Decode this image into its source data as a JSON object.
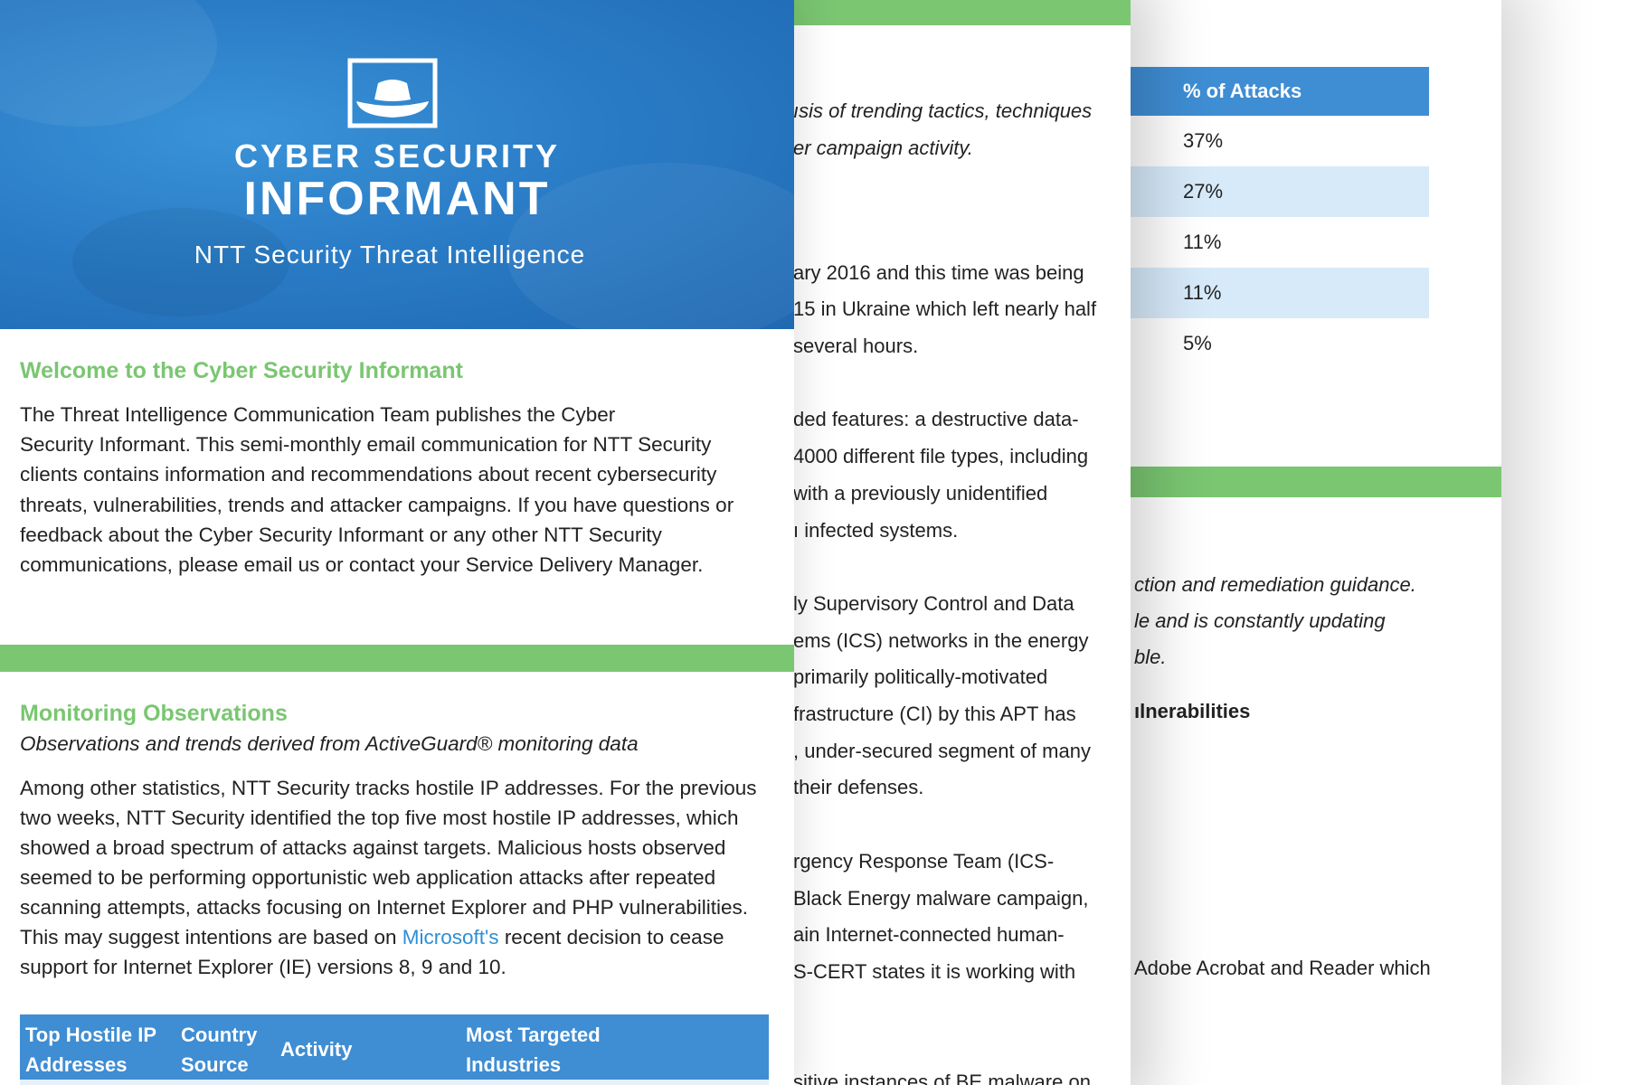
{
  "back_page": {
    "table": {
      "header": "% of Attacks",
      "rows": [
        "37%",
        "27%",
        "11%",
        "11%",
        "5%"
      ]
    },
    "lines": [
      "ction and remediation guidance.",
      "le and is constantly updating",
      "ble.",
      "ılnerabilities",
      "Adobe Acrobat and Reader which"
    ]
  },
  "middle_page": {
    "intro_lines": [
      "ısis of trending tactics, techniques",
      "er campaign activity."
    ],
    "body_lines": [
      "ary 2016 and this time was being",
      "15 in Ukraine which left nearly half",
      "several hours.",
      "ded features: a destructive data-",
      "4000 different file types, including",
      "with a previously unidentified",
      "ı infected systems.",
      "ly Supervisory Control and Data",
      "ems (ICS) networks in the energy",
      "primarily politically-motivated",
      "frastructure (CI) by this APT has",
      ", under-secured segment of many",
      "their defenses.",
      "rgency Response Team (ICS-",
      "Black Energy malware campaign,",
      "ain Internet-connected human-",
      "S-CERT states it is working with",
      "sitive instances of BE malware on"
    ]
  },
  "banner": {
    "title_line1": "CYBER SECURITY",
    "title_line2": "INFORMANT",
    "subtitle": "NTT Security Threat Intelligence",
    "colors": {
      "banner_blue": "#2a7cc6",
      "accent_green": "#7ac671",
      "table_blue": "#3f8dd3",
      "link_blue": "#2d8fd5"
    }
  },
  "welcome": {
    "title": "Welcome to the Cyber Security Informant",
    "lines": [
      "The Threat Intelligence Communication Team publishes the Cyber",
      "Security Informant. This semi-monthly email communication for NTT Security",
      "clients contains information and recommendations about recent cybersecurity",
      "threats, vulnerabilities, trends and attacker campaigns. If you have questions or",
      "feedback about the Cyber Security Informant or any other NTT Security",
      "communications, please email us or contact  your Service Delivery Manager."
    ]
  },
  "monitoring": {
    "title": "Monitoring Observations",
    "subtitle": "Observations and trends derived from ActiveGuard® monitoring data",
    "lines": [
      "Among other statistics, NTT Security tracks hostile IP addresses. For the previous",
      "two weeks, NTT Security identified the top five most hostile IP addresses, which",
      "showed a broad spectrum of attacks against targets. Malicious hosts observed",
      "seemed to be performing opportunistic web application attacks after repeated",
      "scanning attempts, attacks focusing on Internet Explorer and PHP vulnerabilities."
    ],
    "line6_pre": "This may suggest intentions are based on ",
    "line6_link": "Microsoft's",
    "line6_post": " recent decision to cease",
    "line7": "support for Internet Explorer (IE) versions 8, 9 and 10."
  },
  "hostile_table": {
    "col1": [
      "Top Hostile IP",
      "Addresses"
    ],
    "col2": [
      "Country",
      "Source"
    ],
    "col3": "Activity",
    "col4": [
      "Most Targeted",
      "Industries"
    ]
  }
}
